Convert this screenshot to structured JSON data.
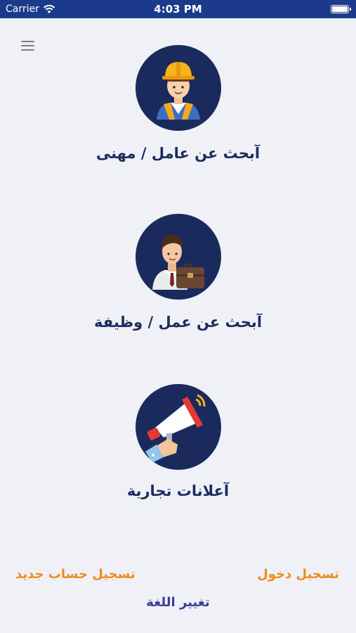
{
  "status_bar": {
    "carrier": "Carrier",
    "time": "4:03 PM"
  },
  "menu": {
    "icon": "hamburger-menu-icon"
  },
  "options": [
    {
      "label": "آبحث عن عامل / مهنى",
      "icon": "construction-worker-icon"
    },
    {
      "label": "آبحث عن عمل / وظيفة",
      "icon": "businessman-briefcase-icon"
    },
    {
      "label": "آعلانات تجارية",
      "icon": "megaphone-icon"
    }
  ],
  "footer": {
    "login": "تسجيل دخول",
    "register": "تسجيل حساب جديد",
    "change_language": "تغيير اللغة"
  },
  "colors": {
    "status_bar": "#1b3a8b",
    "background": "#eff1f7",
    "circle": "#1b2a5c",
    "label": "#1c2c5e",
    "accent_orange": "#f08a1c",
    "language_link": "#3c3c9c"
  }
}
